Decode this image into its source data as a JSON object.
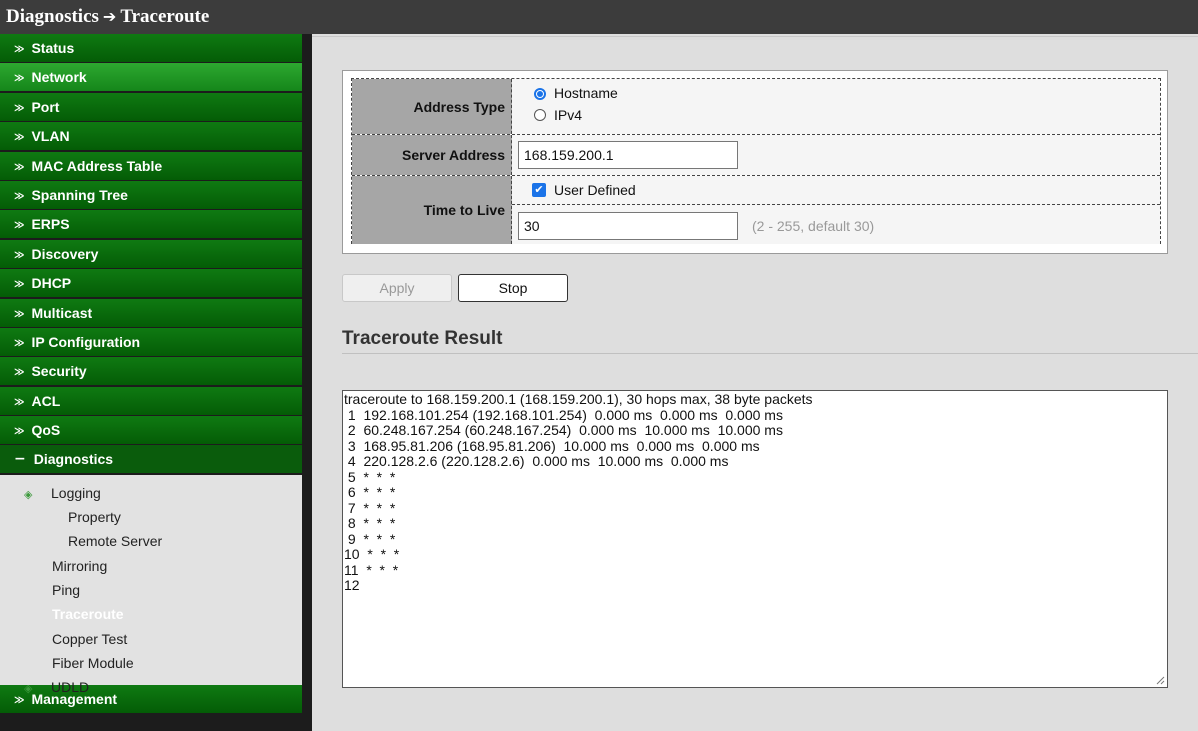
{
  "title": {
    "section": "Diagnostics",
    "arrow": "➔",
    "page": "Traceroute"
  },
  "sidebar": {
    "menu": [
      {
        "label": "Status",
        "chev": "≫"
      },
      {
        "label": "Network",
        "chev": "≫"
      },
      {
        "label": "Port",
        "chev": "≫"
      },
      {
        "label": "VLAN",
        "chev": "≫"
      },
      {
        "label": "MAC Address Table",
        "chev": "≫"
      },
      {
        "label": "Spanning Tree",
        "chev": "≫"
      },
      {
        "label": "ERPS",
        "chev": "≫"
      },
      {
        "label": "Discovery",
        "chev": "≫"
      },
      {
        "label": "DHCP",
        "chev": "≫"
      },
      {
        "label": "Multicast",
        "chev": "≫"
      },
      {
        "label": "IP Configuration",
        "chev": "≫"
      },
      {
        "label": "Security",
        "chev": "≫"
      },
      {
        "label": "ACL",
        "chev": "≫"
      },
      {
        "label": "QoS",
        "chev": "≫"
      }
    ],
    "diagnostics": {
      "label": "Diagnostics",
      "chev": "−"
    },
    "sub": {
      "logging": "Logging",
      "property": "Property",
      "remote_server": "Remote Server",
      "mirroring": "Mirroring",
      "ping": "Ping",
      "traceroute": "Traceroute",
      "copper_test": "Copper Test",
      "fiber_module": "Fiber Module",
      "udld": "UDLD"
    },
    "management": {
      "label": "Management",
      "chev": "≫"
    }
  },
  "form": {
    "address_type_label": "Address Type",
    "hostname_label": "Hostname",
    "ipv4_label": "IPv4",
    "selected_address_type": "Hostname",
    "server_address_label": "Server Address",
    "server_address_value": "168.159.200.1",
    "ttl_label": "Time to Live",
    "user_defined_label": "User Defined",
    "user_defined_checked": true,
    "ttl_value": "30",
    "ttl_hint": "(2 - 255, default 30)"
  },
  "buttons": {
    "apply": "Apply",
    "stop": "Stop"
  },
  "result": {
    "title": "Traceroute Result",
    "lines": [
      "traceroute to 168.159.200.1 (168.159.200.1), 30 hops max, 38 byte packets",
      " 1  192.168.101.254 (192.168.101.254)  0.000 ms  0.000 ms  0.000 ms",
      " 2  60.248.167.254 (60.248.167.254)  0.000 ms  10.000 ms  10.000 ms",
      " 3  168.95.81.206 (168.95.81.206)  10.000 ms  0.000 ms  0.000 ms",
      " 4  220.128.2.6 (220.128.2.6)  0.000 ms  10.000 ms  0.000 ms",
      " 5  *  *  *",
      " 6  *  *  *",
      " 7  *  *  *",
      " 8  *  *  *",
      " 9  *  *  *",
      "10  *  *  *",
      "11  *  *  *",
      "12"
    ]
  },
  "colors": {
    "menu_green": "#0f7a12",
    "highlight_green": "#2da830",
    "accent_blue": "#1a73e8",
    "title_bar": "#3c3c3c"
  }
}
